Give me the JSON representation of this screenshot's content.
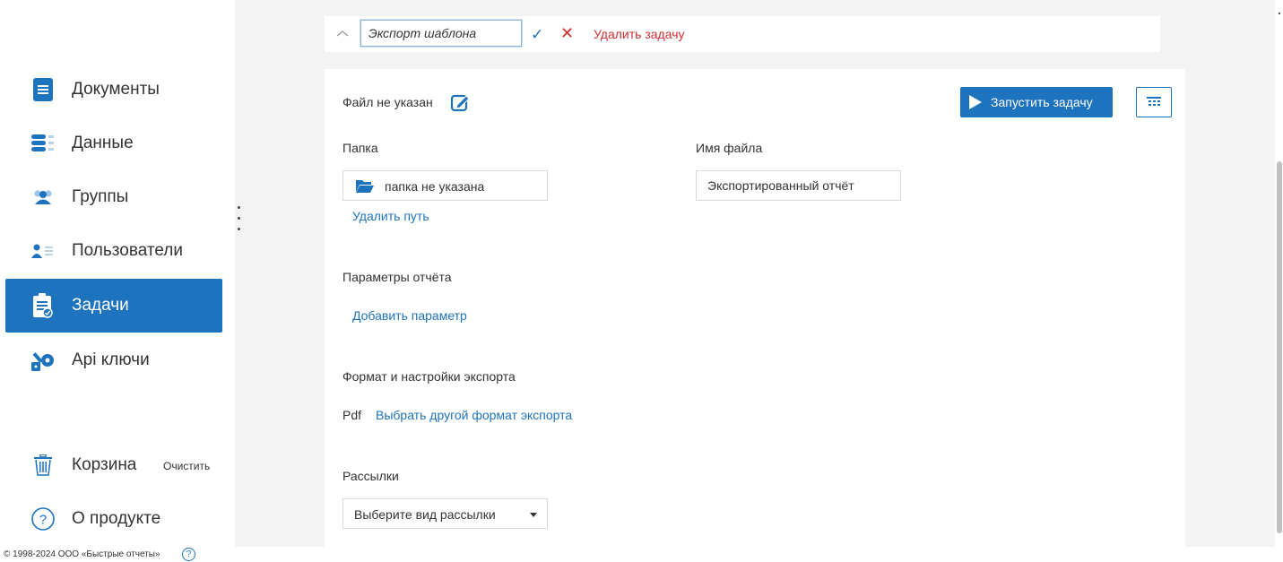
{
  "sidebar": {
    "items": [
      {
        "label": "Документы",
        "icon": "document-icon"
      },
      {
        "label": "Данные",
        "icon": "database-icon"
      },
      {
        "label": "Группы",
        "icon": "groups-icon"
      },
      {
        "label": "Пользователи",
        "icon": "users-icon"
      },
      {
        "label": "Задачи",
        "icon": "tasks-icon",
        "active": true
      },
      {
        "label": "Api ключи",
        "icon": "api-key-icon"
      }
    ],
    "trash": {
      "label": "Корзина",
      "clear_label": "Очистить",
      "icon": "trash-icon"
    },
    "about": {
      "label": "О продукте",
      "icon": "question-icon"
    }
  },
  "task_header": {
    "name_value": "Экспорт шаблона",
    "delete_label": "Удалить задачу"
  },
  "task": {
    "file_status": "Файл не указан",
    "run_label": "Запустить задачу",
    "folder_label": "Папка",
    "folder_value": "папка не указана",
    "remove_path_label": "Удалить путь",
    "filename_label": "Имя файла",
    "filename_value": "Экспортированный отчёт",
    "report_params_label": "Параметры отчёта",
    "add_param_label": "Добавить параметр",
    "export_label": "Формат и настройки экспорта",
    "export_format": "Pdf",
    "change_format_label": "Выбрать другой формат экспорта",
    "mailing_label": "Рассылки",
    "mailing_select": "Выберите вид рассылки"
  },
  "footer": {
    "copyright": "© 1998-2024 ООО «Быстрые отчеты»",
    "help_glyph": "?"
  },
  "colors": {
    "accent": "#1e73be",
    "danger": "#d32f2f",
    "background": "#f3f3f3"
  }
}
